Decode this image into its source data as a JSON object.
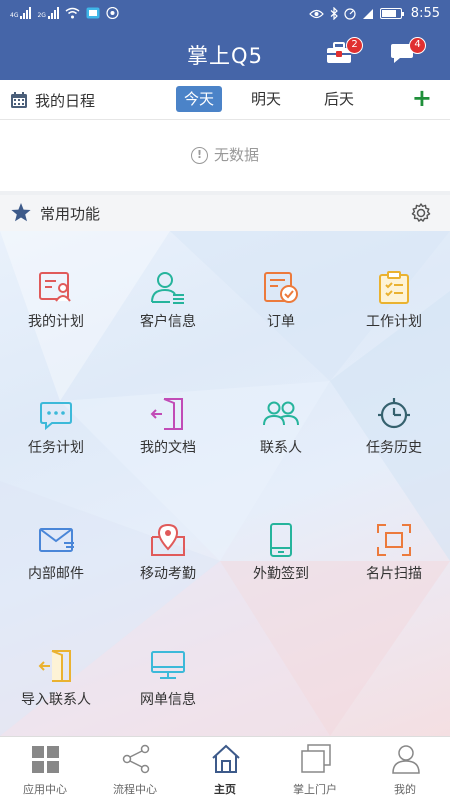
{
  "status_bar": {
    "net1": "4G",
    "net2": "2G",
    "battery": "80",
    "time": "8:55"
  },
  "header": {
    "title": "掌上Q5",
    "toolbox_badge": "2",
    "message_badge": "4"
  },
  "schedule": {
    "title": "我的日程",
    "tabs": [
      "今天",
      "明天",
      "后天"
    ],
    "active_tab": "今天",
    "empty_text": "无数据"
  },
  "common_functions": {
    "title": "常用功能",
    "items": [
      {
        "label": "我的计划",
        "icon": "plan-icon",
        "color": "#e05a5a"
      },
      {
        "label": "客户信息",
        "icon": "customer-icon",
        "color": "#26b49c"
      },
      {
        "label": "订单",
        "icon": "order-icon",
        "color": "#ec7a3c"
      },
      {
        "label": "工作计划",
        "icon": "clipboard-icon",
        "color": "#eab230"
      },
      {
        "label": "任务计划",
        "icon": "task-plan-icon",
        "color": "#3cb9d9"
      },
      {
        "label": "我的文档",
        "icon": "document-icon",
        "color": "#c14bb6"
      },
      {
        "label": "联系人",
        "icon": "contacts-icon",
        "color": "#26b49c"
      },
      {
        "label": "任务历史",
        "icon": "history-icon",
        "color": "#35616e"
      },
      {
        "label": "内部邮件",
        "icon": "mail-icon",
        "color": "#4a86d8"
      },
      {
        "label": "移动考勤",
        "icon": "location-icon",
        "color": "#e05a5a"
      },
      {
        "label": "外勤签到",
        "icon": "phone-icon",
        "color": "#26b49c"
      },
      {
        "label": "名片扫描",
        "icon": "scan-icon",
        "color": "#ec7a3c"
      },
      {
        "label": "导入联系人",
        "icon": "import-icon",
        "color": "#eab230"
      },
      {
        "label": "网单信息",
        "icon": "monitor-icon",
        "color": "#3cb9d9"
      }
    ]
  },
  "bottom_nav": {
    "items": [
      {
        "label": "应用中心",
        "icon": "app-grid-icon"
      },
      {
        "label": "流程中心",
        "icon": "share-icon"
      },
      {
        "label": "主页",
        "icon": "home-icon"
      },
      {
        "label": "掌上门户",
        "icon": "windows-icon"
      },
      {
        "label": "我的",
        "icon": "user-icon"
      }
    ],
    "active": "主页"
  },
  "colors": {
    "header_bg": "#4565a8",
    "tab_active_bg": "#4b83c8",
    "add_green": "#1f8f3a",
    "badge_red": "#e03030"
  }
}
